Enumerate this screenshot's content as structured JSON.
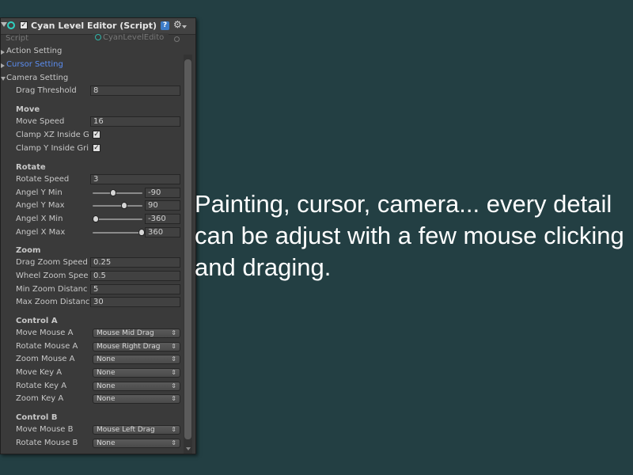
{
  "header": {
    "title": "Cyan Level Editor (Script)",
    "help_glyph": "?",
    "check_glyph": "✓"
  },
  "script_row": {
    "label": "Script",
    "value": "CyanLevelEdito"
  },
  "folds": [
    {
      "label": "Action Setting",
      "expanded": false,
      "highlight": false
    },
    {
      "label": "Cursor Setting",
      "expanded": false,
      "highlight": true
    },
    {
      "label": "Camera Setting",
      "expanded": true,
      "highlight": false
    }
  ],
  "drag_threshold": {
    "label": "Drag Threshold",
    "value": "8"
  },
  "move": {
    "title": "Move",
    "speed": {
      "label": "Move Speed",
      "value": "16"
    },
    "clamp_xz": {
      "label": "Clamp XZ Inside G",
      "checked": true
    },
    "clamp_y": {
      "label": "Clamp Y Inside Gri",
      "checked": true
    }
  },
  "rotate": {
    "title": "Rotate",
    "speed": {
      "label": "Rotate Speed",
      "value": "3"
    },
    "sliders": [
      {
        "label": "Angel Y Min",
        "value": "-90",
        "pos": 0.38
      },
      {
        "label": "Angel Y Max",
        "value": "90",
        "pos": 0.62
      },
      {
        "label": "Angel X Min",
        "value": "-360",
        "pos": 0.0
      },
      {
        "label": "Angel X Max",
        "value": "360",
        "pos": 1.0
      }
    ]
  },
  "zoom": {
    "title": "Zoom",
    "fields": [
      {
        "label": "Drag Zoom Speed",
        "value": "0.25"
      },
      {
        "label": "Wheel Zoom Spee",
        "value": "0.5"
      },
      {
        "label": "Min Zoom Distanc",
        "value": "5"
      },
      {
        "label": "Max Zoom Distanc",
        "value": "30"
      }
    ]
  },
  "control_a": {
    "title": "Control A",
    "items": [
      {
        "label": "Move Mouse A",
        "value": "Mouse Mid Drag"
      },
      {
        "label": "Rotate Mouse A",
        "value": "Mouse Right Drag"
      },
      {
        "label": "Zoom Mouse A",
        "value": "None"
      },
      {
        "label": "Move Key A",
        "value": "None"
      },
      {
        "label": "Rotate Key A",
        "value": "None"
      },
      {
        "label": "Zoom Key A",
        "value": "None"
      }
    ]
  },
  "control_b": {
    "title": "Control B",
    "items": [
      {
        "label": "Move Mouse B",
        "value": "Mouse Left Drag"
      },
      {
        "label": "Rotate Mouse B",
        "value": "None"
      }
    ]
  },
  "dropdown_arrow": "⇕",
  "caption": "Painting, cursor, camera... every detail can be adjust with a few mouse clicking and draging."
}
